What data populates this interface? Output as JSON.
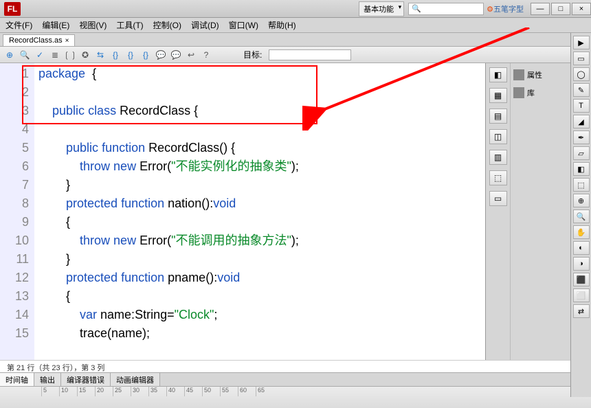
{
  "title_dropdown": "基本功能",
  "search_placeholder": "🔍",
  "ime_text": "五笔字型",
  "window_buttons": {
    "min": "—",
    "max": "□",
    "close": "×"
  },
  "menus": [
    "文件(F)",
    "编辑(E)",
    "视图(V)",
    "工具(T)",
    "控制(O)",
    "调试(D)",
    "窗口(W)",
    "帮助(H)"
  ],
  "tab": {
    "label": "RecordClass.as",
    "close": "×"
  },
  "toolbar_target_label": "目标:",
  "code_lines": [
    {
      "n": "1",
      "html": "<span class='kw'>package</span>&nbsp;&nbsp;{"
    },
    {
      "n": "2",
      "html": ""
    },
    {
      "n": "3",
      "html": "&nbsp;&nbsp;&nbsp;&nbsp;<span class='kw'>public</span> <span class='kw'>class</span> <span class='cls'>RecordClass</span> {"
    },
    {
      "n": "4",
      "html": ""
    },
    {
      "n": "5",
      "html": "&nbsp;&nbsp;&nbsp;&nbsp;&nbsp;&nbsp;&nbsp;&nbsp;<span class='kw'>public</span> <span class='kw'>function</span> <span class='cls'>RecordClass</span>() {"
    },
    {
      "n": "6",
      "html": "&nbsp;&nbsp;&nbsp;&nbsp;&nbsp;&nbsp;&nbsp;&nbsp;&nbsp;&nbsp;&nbsp;&nbsp;<span class='kw'>throw</span> <span class='kw'>new</span> <span class='cls'>Error</span>(<span class='str'>\"不能实例化的抽象类\"</span>);"
    },
    {
      "n": "7",
      "html": "&nbsp;&nbsp;&nbsp;&nbsp;&nbsp;&nbsp;&nbsp;&nbsp;}"
    },
    {
      "n": "8",
      "html": "&nbsp;&nbsp;&nbsp;&nbsp;&nbsp;&nbsp;&nbsp;&nbsp;<span class='kw'>protected</span> <span class='kw'>function</span> <span class='cls'>nation</span>():<span class='kw'>void</span>"
    },
    {
      "n": "9",
      "html": "&nbsp;&nbsp;&nbsp;&nbsp;&nbsp;&nbsp;&nbsp;&nbsp;{"
    },
    {
      "n": "10",
      "html": "&nbsp;&nbsp;&nbsp;&nbsp;&nbsp;&nbsp;&nbsp;&nbsp;&nbsp;&nbsp;&nbsp;&nbsp;<span class='kw'>throw</span> <span class='kw'>new</span> <span class='cls'>Error</span>(<span class='str'>\"不能调用的抽象方法\"</span>);"
    },
    {
      "n": "11",
      "html": "&nbsp;&nbsp;&nbsp;&nbsp;&nbsp;&nbsp;&nbsp;&nbsp;}"
    },
    {
      "n": "12",
      "html": "&nbsp;&nbsp;&nbsp;&nbsp;&nbsp;&nbsp;&nbsp;&nbsp;<span class='kw'>protected</span> <span class='kw'>function</span> <span class='cls'>pname</span>():<span class='kw'>void</span>"
    },
    {
      "n": "13",
      "html": "&nbsp;&nbsp;&nbsp;&nbsp;&nbsp;&nbsp;&nbsp;&nbsp;{"
    },
    {
      "n": "14",
      "html": "&nbsp;&nbsp;&nbsp;&nbsp;&nbsp;&nbsp;&nbsp;&nbsp;&nbsp;&nbsp;&nbsp;&nbsp;<span class='kw'>var</span> name:<span class='cls'>String</span>=<span class='str'>\"Clock\"</span>;"
    },
    {
      "n": "15",
      "html": "&nbsp;&nbsp;&nbsp;&nbsp;&nbsp;&nbsp;&nbsp;&nbsp;&nbsp;&nbsp;&nbsp;&nbsp;trace(name);"
    }
  ],
  "status": "第 21 行（共 23 行），第 3 列",
  "bottom_tabs": [
    "时间轴",
    "输出",
    "编译器错误",
    "动画编辑器"
  ],
  "timeline_ticks": [
    "5",
    "10",
    "15",
    "20",
    "25",
    "30",
    "35",
    "40",
    "45",
    "50",
    "55",
    "60",
    "65"
  ],
  "panels": {
    "props": "属性",
    "lib": "库"
  },
  "panel_icons": [
    "◧",
    "▦",
    "▤",
    "◫",
    "▥",
    "⬚",
    "▭"
  ]
}
